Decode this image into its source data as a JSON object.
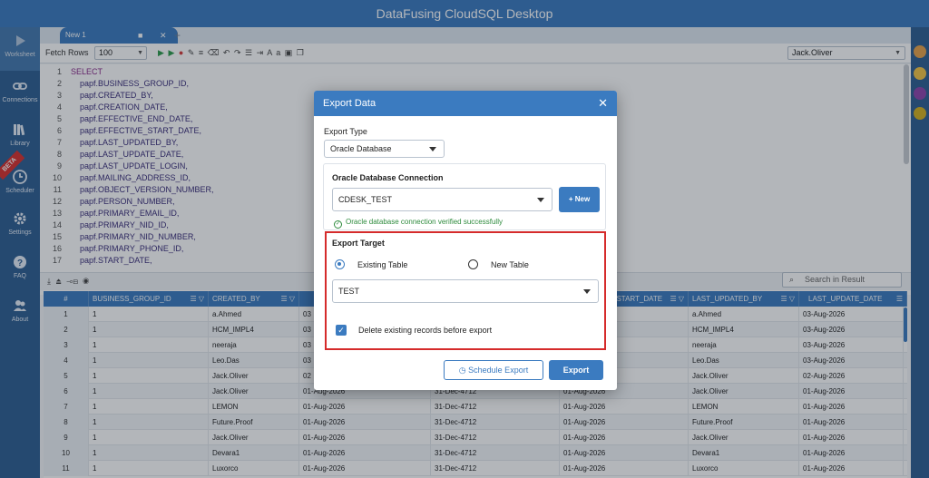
{
  "app": {
    "title": "DataFusing CloudSQL Desktop"
  },
  "sidebar": {
    "items": [
      {
        "label": "Worksheet"
      },
      {
        "label": "Connections"
      },
      {
        "label": "Library"
      },
      {
        "label": "Scheduler"
      },
      {
        "label": "Settings"
      },
      {
        "label": "FAQ"
      },
      {
        "label": "About"
      }
    ],
    "beta_label": "BETA"
  },
  "tabs": [
    {
      "label": "New 1"
    }
  ],
  "toolbar": {
    "fetch_rows_label": "Fetch Rows",
    "fetch_rows_value": "100",
    "font_small": "A",
    "font_large": "a",
    "user_value": "Jack.Oliver"
  },
  "editor": {
    "lines": [
      {
        "n": "1",
        "text": "SELECT"
      },
      {
        "n": "2",
        "text": "papf.BUSINESS_GROUP_ID,"
      },
      {
        "n": "3",
        "text": "papf.CREATED_BY,"
      },
      {
        "n": "4",
        "text": "papf.CREATION_DATE,"
      },
      {
        "n": "5",
        "text": "papf.EFFECTIVE_END_DATE,"
      },
      {
        "n": "6",
        "text": "papf.EFFECTIVE_START_DATE,"
      },
      {
        "n": "7",
        "text": "papf.LAST_UPDATED_BY,"
      },
      {
        "n": "8",
        "text": "papf.LAST_UPDATE_DATE,"
      },
      {
        "n": "9",
        "text": "papf.LAST_UPDATE_LOGIN,"
      },
      {
        "n": "10",
        "text": "papf.MAILING_ADDRESS_ID,"
      },
      {
        "n": "11",
        "text": "papf.OBJECT_VERSION_NUMBER,"
      },
      {
        "n": "12",
        "text": "papf.PERSON_NUMBER,"
      },
      {
        "n": "13",
        "text": "papf.PRIMARY_EMAIL_ID,"
      },
      {
        "n": "14",
        "text": "papf.PRIMARY_NID_ID,"
      },
      {
        "n": "15",
        "text": "papf.PRIMARY_NID_NUMBER,"
      },
      {
        "n": "16",
        "text": "papf.PRIMARY_PHONE_ID,"
      },
      {
        "n": "17",
        "text": "papf.START_DATE,"
      }
    ]
  },
  "results": {
    "search_placeholder": "Search in Result",
    "columns": [
      {
        "label": "#"
      },
      {
        "label": "BUSINESS_GROUP_ID"
      },
      {
        "label": "CREATED_BY"
      },
      {
        "label": ""
      },
      {
        "label": ""
      },
      {
        "label": "_START_DATE"
      },
      {
        "label": "LAST_UPDATED_BY"
      },
      {
        "label": "LAST_UPDATE_DATE"
      }
    ],
    "rows": [
      [
        "1",
        "1",
        "a.Ahmed",
        "03",
        "",
        "",
        "a.Ahmed",
        "03-Aug-2026"
      ],
      [
        "2",
        "1",
        "HCM_IMPL4",
        "03",
        "",
        "",
        "HCM_IMPL4",
        "03-Aug-2026"
      ],
      [
        "3",
        "1",
        "neeraja",
        "03",
        "",
        "",
        "neeraja",
        "03-Aug-2026"
      ],
      [
        "4",
        "1",
        "Leo.Das",
        "03",
        "",
        "",
        "Leo.Das",
        "03-Aug-2026"
      ],
      [
        "5",
        "1",
        "Jack.Oliver",
        "02",
        "",
        "",
        "Jack.Oliver",
        "02-Aug-2026"
      ],
      [
        "6",
        "1",
        "Jack.Oliver",
        "01-Aug-2026",
        "31-Dec-4712",
        "01-Aug-2026",
        "Jack.Oliver",
        "01-Aug-2026"
      ],
      [
        "7",
        "1",
        "LEMON",
        "01-Aug-2026",
        "31-Dec-4712",
        "01-Aug-2026",
        "LEMON",
        "01-Aug-2026"
      ],
      [
        "8",
        "1",
        "Future.Proof",
        "01-Aug-2026",
        "31-Dec-4712",
        "01-Aug-2026",
        "Future.Proof",
        "01-Aug-2026"
      ],
      [
        "9",
        "1",
        "Jack.Oliver",
        "01-Aug-2026",
        "31-Dec-4712",
        "01-Aug-2026",
        "Jack.Oliver",
        "01-Aug-2026"
      ],
      [
        "10",
        "1",
        "Devara1",
        "01-Aug-2026",
        "31-Dec-4712",
        "01-Aug-2026",
        "Devara1",
        "01-Aug-2026"
      ],
      [
        "11",
        "1",
        "Luxorco",
        "01-Aug-2026",
        "31-Dec-4712",
        "01-Aug-2026",
        "Luxorco",
        "01-Aug-2026"
      ]
    ]
  },
  "dialog": {
    "title": "Export Data",
    "export_type_label": "Export Type",
    "export_type_value": "Oracle Database",
    "connection_label": "Oracle Database Connection",
    "connection_value": "CDESK_TEST",
    "new_button": "+ New",
    "verified_message": "Oracle database connection verified successfully",
    "target_label": "Export Target",
    "existing_table_label": "Existing Table",
    "new_table_label": "New Table",
    "table_value": "TEST",
    "delete_label": "Delete existing records before export",
    "schedule_button": "Schedule Export",
    "export_button": "Export"
  },
  "colors": {
    "brand": "#3b7bc0",
    "sidebar": "#2f5f93",
    "highlight": "#d52b2b",
    "success": "#2e8b3d"
  }
}
